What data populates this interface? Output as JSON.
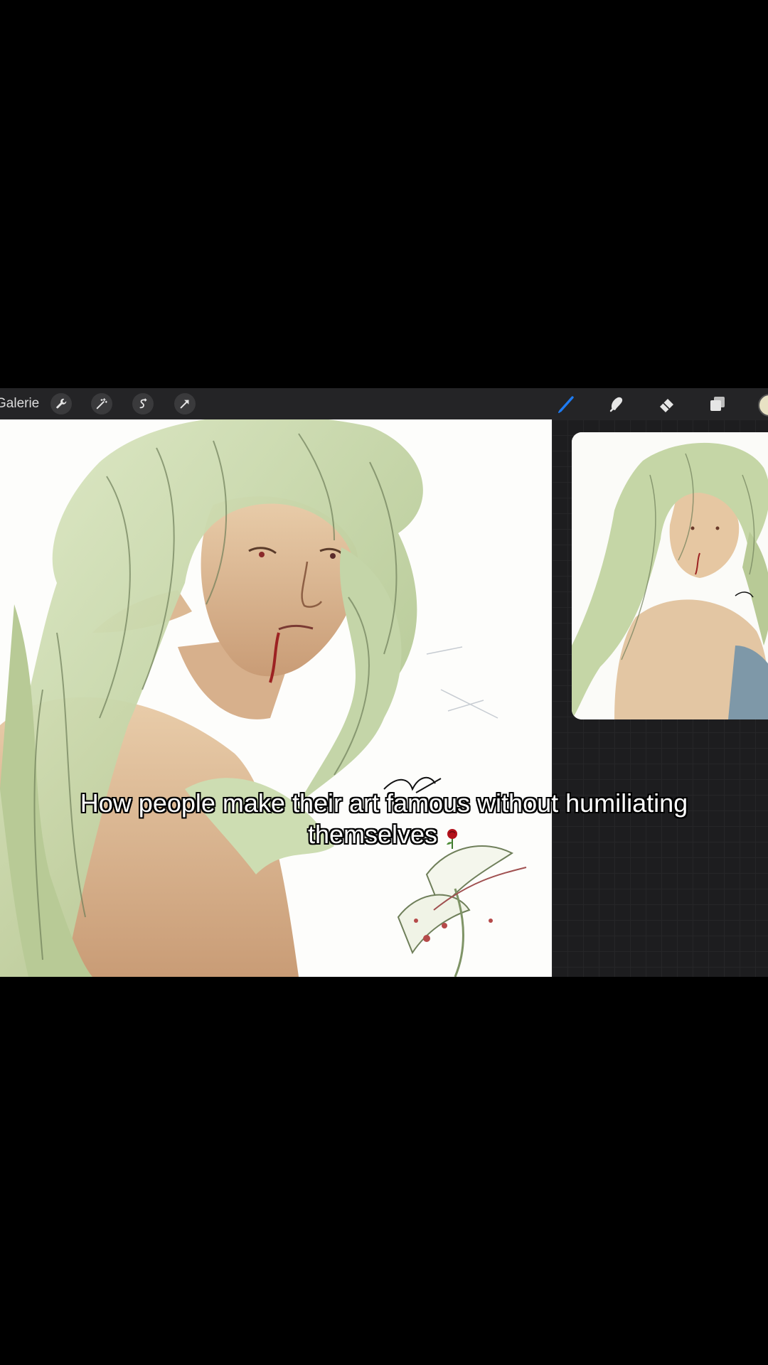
{
  "toolbar": {
    "gallery_label": "Galerie",
    "left_tools": [
      "wrench-icon",
      "magic-wand-icon",
      "selection-icon",
      "transform-arrow-icon"
    ],
    "right_tools": [
      "brush-icon",
      "smudge-icon",
      "eraser-icon",
      "layers-icon"
    ],
    "active_tool": "brush-icon",
    "active_color": "#1e7bf2",
    "current_color": "#e8e2c4"
  },
  "caption": {
    "line1": "How people make their art famous without humiliating",
    "line2": "themselves",
    "emoji": "rose-emoji"
  }
}
